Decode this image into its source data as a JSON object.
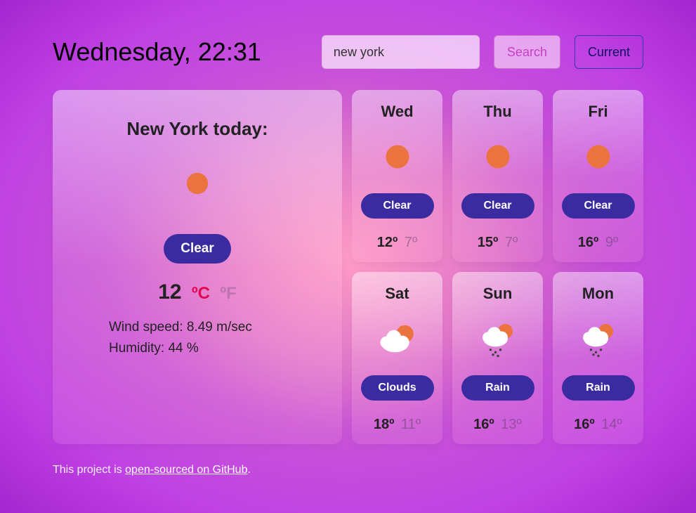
{
  "datetime": "Wednesday, 22:31",
  "search": {
    "value": "new york",
    "search_label": "Search",
    "current_label": "Current"
  },
  "today": {
    "title": "New York today:",
    "icon": "sun",
    "condition": "Clear",
    "temp": "12",
    "unit_c": "ºC",
    "unit_f": "ºF",
    "active_unit": "c",
    "wind_label": "Wind speed: 8.49 m/sec",
    "humidity_label": "Humidity: 44 %"
  },
  "forecast": [
    {
      "day": "Wed",
      "icon": "sun",
      "condition": "Clear",
      "high": "12º",
      "low": "7º"
    },
    {
      "day": "Thu",
      "icon": "sun",
      "condition": "Clear",
      "high": "15º",
      "low": "7º"
    },
    {
      "day": "Fri",
      "icon": "sun",
      "condition": "Clear",
      "high": "16º",
      "low": "9º"
    },
    {
      "day": "Sat",
      "icon": "cloud-sun",
      "condition": "Clouds",
      "high": "18º",
      "low": "11º"
    },
    {
      "day": "Sun",
      "icon": "rain",
      "condition": "Rain",
      "high": "16º",
      "low": "13º"
    },
    {
      "day": "Mon",
      "icon": "rain",
      "condition": "Rain",
      "high": "16º",
      "low": "14º"
    }
  ],
  "footer": {
    "prefix": "This project is ",
    "link_text": "open-sourced on GitHub",
    "suffix": "."
  }
}
